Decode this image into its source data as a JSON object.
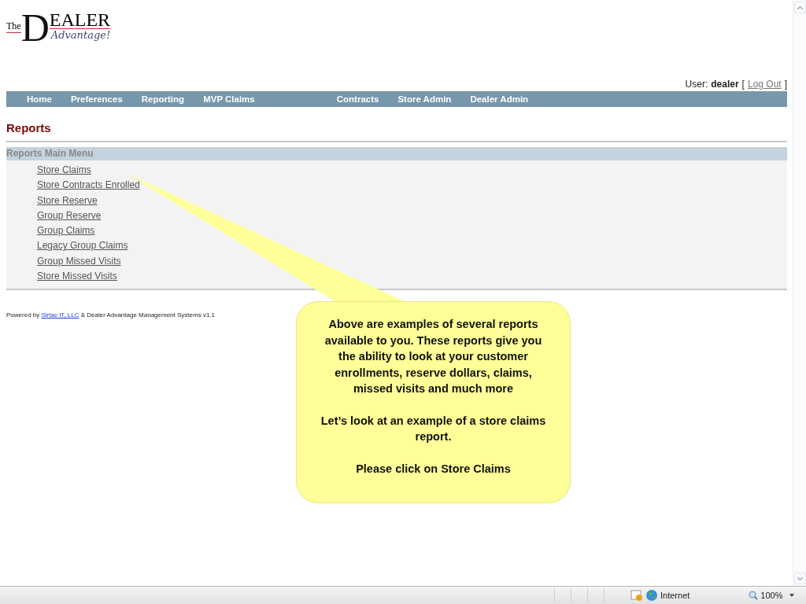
{
  "logo": {
    "prefix": "The",
    "initial": "D",
    "rest": "EALER",
    "tagline": "Advantage!"
  },
  "user": {
    "label": "User:",
    "name": "dealer",
    "open_bracket": "[",
    "logout": "Log Out",
    "close_bracket": "]"
  },
  "nav": [
    {
      "label": "Home",
      "kind": "main"
    },
    {
      "label": "Preferences",
      "kind": "main"
    },
    {
      "label": "Reporting",
      "kind": "main"
    },
    {
      "label": "MVP Claims",
      "kind": "main"
    },
    {
      "label": "Contracts",
      "kind": "admin"
    },
    {
      "label": "Store Admin",
      "kind": "admin"
    },
    {
      "label": "Dealer Admin",
      "kind": "admin"
    }
  ],
  "page_title": "Reports",
  "menu": {
    "title": "Reports Main Menu",
    "items": [
      "Store Claims",
      "Store Contracts Enrolled",
      "Store Reserve",
      "Group Reserve",
      "Group Claims",
      "Legacy Group Claims",
      "Group Missed Visits",
      "Store Missed Visits"
    ]
  },
  "footer": {
    "before": "Powered by",
    "link": "Sirtac IT, LLC",
    "after": "& Dealer Advantage Management Systems v1.1"
  },
  "callout": {
    "paragraphs": [
      "Above are examples of several reports available to you. These reports give you the ability to look at your customer enrollments, reserve dollars, claims, missed visits and much more",
      "Let’s look at an example of a store claims report.",
      "Please click on Store Claims"
    ]
  },
  "status_bar": {
    "zone": "Internet",
    "zoom": "100%"
  }
}
